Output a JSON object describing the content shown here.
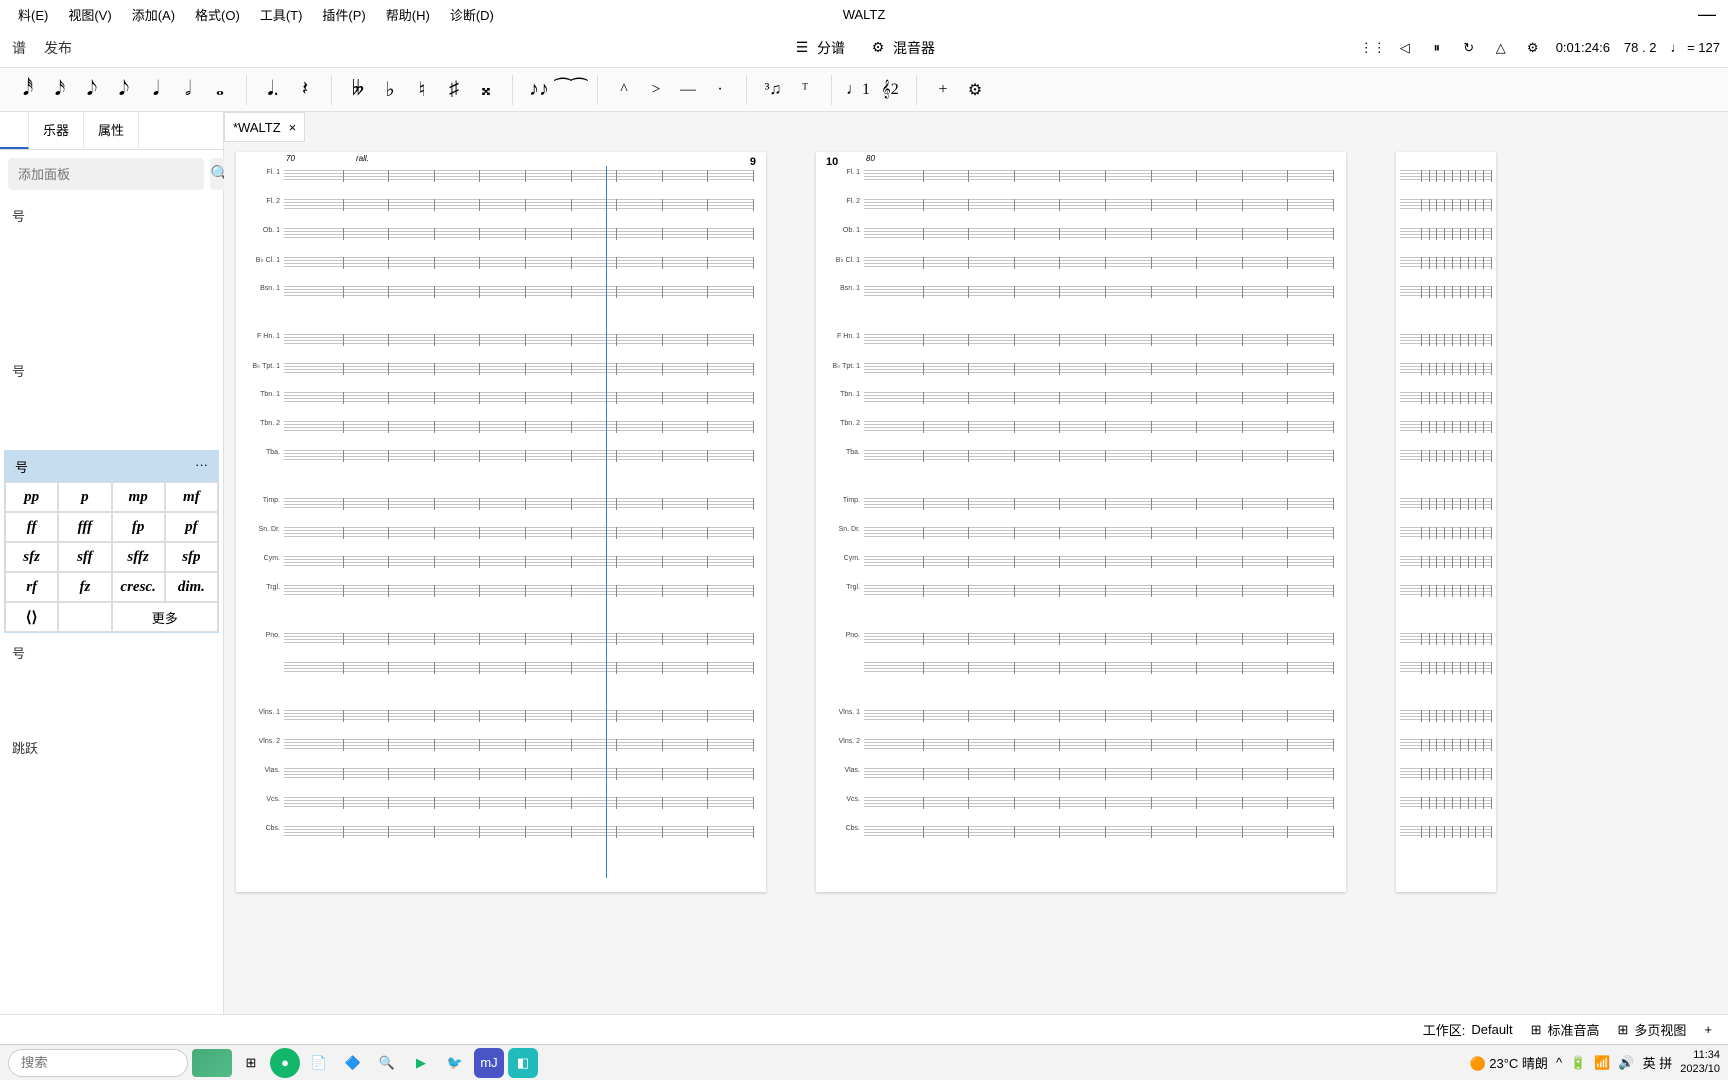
{
  "window": {
    "title": "WALTZ",
    "minimize": "—"
  },
  "menubar": [
    "料(E)",
    "视图(V)",
    "添加(A)",
    "格式(O)",
    "工具(T)",
    "插件(P)",
    "帮助(H)",
    "诊断(D)"
  ],
  "toolbar1": {
    "home": "谱",
    "publish": "发布",
    "parts": "分谱",
    "mixer": "混音器",
    "time": "0:01:24:6",
    "measure": "78 . 2",
    "tempo_prefix": "♩ =",
    "tempo": "127"
  },
  "notes": {
    "durations": [
      "𝅘𝅥𝅰",
      "𝅘𝅥𝅯",
      "𝅘𝅥𝅮",
      "𝅘𝅥𝅮",
      "𝅘𝅥",
      "𝅗𝅥",
      "𝅝"
    ],
    "dot_rest": [
      "𝅘𝅥.",
      "𝄽"
    ],
    "accidentals": [
      "𝄫",
      "♭",
      "♮",
      "♯",
      "𝄪"
    ],
    "ties": [
      "♪♪",
      "⁀⁀"
    ],
    "artic": [
      "^",
      ">",
      "—",
      "·"
    ],
    "tuplet": [
      "³♫",
      "ᵀ"
    ],
    "voice": [
      "♩1",
      "𝄞2"
    ],
    "extra": [
      "+",
      "⚙"
    ]
  },
  "sidebar": {
    "tabs": [
      "",
      "乐器",
      "属性"
    ],
    "search_placeholder": "添加面板",
    "sections": [
      "号",
      "号"
    ],
    "dyn_title": "号",
    "dyn_dots": "···",
    "dynamics": [
      "pp",
      "p",
      "mp",
      "mf",
      "ff",
      "fff",
      "fp",
      "pf",
      "sfz",
      "sff",
      "sffz",
      "sfp",
      "rf",
      "fz",
      "cresc.",
      "dim."
    ],
    "hairpin": "⟨⟩",
    "more": "更多",
    "sections2": [
      "号",
      "跳跃"
    ]
  },
  "doctab": {
    "name": "*WALTZ",
    "close": "×"
  },
  "score": {
    "pages": [
      {
        "num": "9",
        "num_side": "right",
        "measure_start": "70",
        "marking_top": "rall."
      },
      {
        "num": "10",
        "num_side": "left",
        "measure_start": "80"
      }
    ],
    "instruments": [
      "Fl. 1",
      "Fl. 2",
      "Ob. 1",
      "B♭ Cl. 1",
      "Bsn. 1",
      "F Hn. 1",
      "B♭ Tpt. 1",
      "Tbn. 1",
      "Tbn. 2",
      "Tba.",
      "Timp.",
      "Sn. Dr.",
      "Cym.",
      "Trgl.",
      "Pno.",
      "",
      "Vlns. 1",
      "Vlns. 2",
      "Vlas.",
      "Vcs.",
      "Cbs."
    ],
    "gaps_after": [
      4,
      9,
      13,
      15
    ],
    "dynamics_marks": {
      "pp": "pp",
      "p": "p",
      "mp": "mp"
    }
  },
  "statusbar": {
    "workspace_label": "工作区:",
    "workspace": "Default",
    "pitch": "标准音高",
    "view": "多页视图",
    "zoom_plus": "+"
  },
  "taskbar": {
    "search": "搜索",
    "weather": "23°C 晴朗",
    "ime": "英 拼",
    "time": "11:34",
    "date": "2023/10"
  }
}
